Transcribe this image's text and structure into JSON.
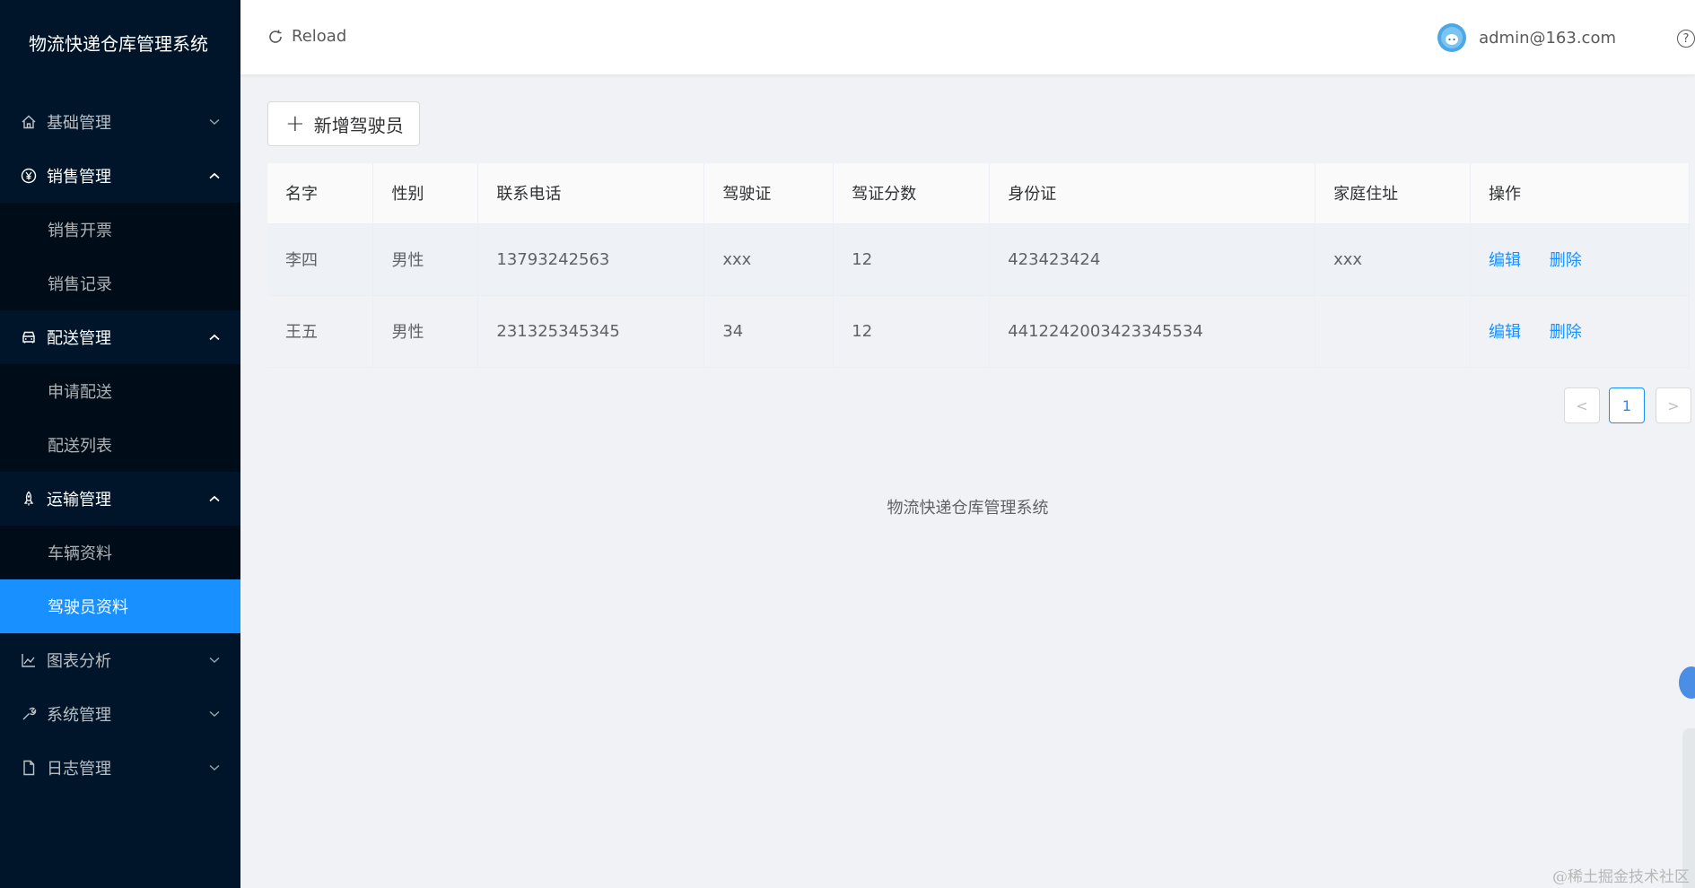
{
  "app": {
    "title": "物流快递仓库管理系统"
  },
  "sidebar": {
    "menus": [
      {
        "label": "基础管理"
      },
      {
        "label": "销售管理",
        "children": [
          "销售开票",
          "销售记录"
        ]
      },
      {
        "label": "配送管理",
        "children": [
          "申请配送",
          "配送列表"
        ]
      },
      {
        "label": "运输管理",
        "children": [
          "车辆资料",
          "驾驶员资料"
        ]
      },
      {
        "label": "图表分析"
      },
      {
        "label": "系统管理"
      },
      {
        "label": "日志管理"
      }
    ]
  },
  "header": {
    "reload_label": "Reload",
    "user_email": "admin@163.com",
    "help_glyph": "?"
  },
  "toolbar": {
    "add_label": "新增驾驶员"
  },
  "table": {
    "headers": [
      "名字",
      "性别",
      "联系电话",
      "驾驶证",
      "驾证分数",
      "身份证",
      "家庭住址",
      "操作"
    ],
    "rows": [
      [
        "李四",
        "男性",
        "13793242563",
        "xxx",
        "12",
        "423423424",
        "xxx"
      ],
      [
        "王五",
        "男性",
        "231325345345",
        "34",
        "12",
        "4412242003423345534",
        ""
      ]
    ],
    "actions": {
      "edit": "编辑",
      "delete": "删除"
    }
  },
  "pagination": {
    "current": "1",
    "prev_glyph": "<",
    "next_glyph": ">"
  },
  "footer": {
    "text": "物流快递仓库管理系统"
  },
  "watermark": "@稀土掘金技术社区",
  "colors": {
    "sidebar_bg": "#001529",
    "submenu_bg": "#000c17",
    "accent": "#1890ff",
    "page_bg": "#f0f2f5"
  },
  "icons": [
    "home-icon",
    "yen-icon",
    "car-icon",
    "rocket-icon",
    "chart-icon",
    "wrench-icon",
    "file-icon",
    "reload-icon",
    "help-icon"
  ]
}
